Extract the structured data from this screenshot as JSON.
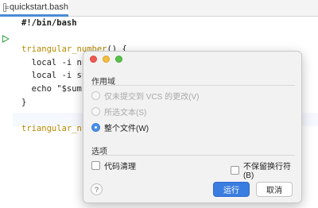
{
  "editor": {
    "tab_label": "quickstart.bash",
    "lines": [
      "#!/bin/bash",
      "",
      "triangular_number() {",
      "  local -i numb",
      "  local -i sum=",
      "  echo \"$sum\"",
      "}",
      "",
      "triangular_numb"
    ]
  },
  "dialog": {
    "scope_label": "作用域",
    "scope_options": [
      {
        "label": "仅未提交到 VCS 的更改(V)",
        "selected": false,
        "enabled": false
      },
      {
        "label": "所选文本(S)",
        "selected": false,
        "enabled": false
      },
      {
        "label": "整个文件(W)",
        "selected": true,
        "enabled": true
      }
    ],
    "options_label": "选项",
    "checkbox_cleanup": "代码清理",
    "checkbox_keep_breaks": "不保留换行符(B)",
    "help_label": "?",
    "run_label": "运行",
    "cancel_label": "取消"
  },
  "colors": {
    "accent": "#3a7de0",
    "function_name": "#b58a00",
    "run_icon": "#3aa64b"
  }
}
